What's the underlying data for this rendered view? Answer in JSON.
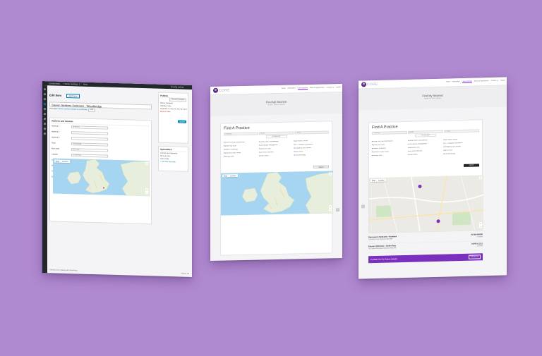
{
  "sheet_wp": {
    "topbar": [
      "Londontown",
      "Theme settings",
      "1",
      "New",
      "Howdy, admin"
    ],
    "heading": "Edit Item",
    "add_new": "Add New",
    "title_value": "Steven Seekers Opticians - Woodbridge",
    "permalink_label": "Permalink:",
    "permalink_url": "steven-seekers-opticians-woodbridge",
    "permalink_button": "Edit",
    "box_title": "Address and location",
    "fields": [
      {
        "label": "Address 1",
        "value": "Station St"
      },
      {
        "label": "Address 2",
        "value": ""
      },
      {
        "label": "Address 3",
        "value": ""
      },
      {
        "label": "Town",
        "value": "Woodbridge"
      },
      {
        "label": "Post code",
        "value": "IP12 1BE"
      },
      {
        "label": "Latitude",
        "value": "52.0904993"
      },
      {
        "label": "Longitude",
        "value": "1.3171505"
      },
      {
        "label": "Website",
        "value": "https://www.stevenseekers.co.uk/woodbridge"
      },
      {
        "label": "Telephone",
        "value": "01394 380000"
      },
      {
        "label": "Email",
        "value": ""
      }
    ],
    "map_tabs": [
      "Map",
      "Satellite"
    ],
    "publish": {
      "title": "Publish",
      "preview": "Preview Changes",
      "status": "Status: Published",
      "visibility": "Visibility: Public",
      "published_on": "Published on: May 26, 2017 @ 13:22",
      "trash": "Move to Trash",
      "update": "Update"
    },
    "services": {
      "title": "Specialities",
      "items": [
        "Contact Lens Specialist",
        "Dry Eye Clinic",
        "Home Visits"
      ],
      "add": "+ Add New Speciality"
    },
    "footer": "Thank you for creating with WordPress.",
    "version": "Version 4.8"
  },
  "sheet_site1": {
    "logo_mark": "e",
    "logo_text": "CORE",
    "nav": [
      "Home",
      "Information",
      "Find a practice",
      "Book an appointment",
      "Contact us",
      "Search"
    ],
    "active_nav": "Find a practice",
    "hero_title": "Find My Nearest",
    "breadcrumb": "Home > Find my nearest",
    "panel_title": "Find A Practice",
    "search_fields": [
      "Postcode",
      "Within",
      "5 miles"
    ],
    "services_dropdown": "All Services",
    "services": [
      "Home Visit Eye Examinations",
      "Contact Lens Consultations",
      "Eye Health Checks",
      "Special Dry Eyes",
      "Child Myopia Management",
      "OCT Imaging Consultation",
      "Diabetic Screening",
      "Glaucoma Clinic",
      "Emergency Eye Service",
      "Specialist Colour Vision",
      "Low Vision Services",
      "Sport Vision",
      "Hearing Tests",
      "Visual Stress",
      "Orthokeratology"
    ],
    "search_button": "Search",
    "map_tabs": [
      "Map",
      "Satellite"
    ]
  },
  "sheet_site2": {
    "logo_mark": "e",
    "logo_text": "CORE",
    "nav": [
      "Home",
      "Information",
      "Find a practice",
      "Book an appointment",
      "Contact us",
      "Search"
    ],
    "active_nav": "Find a practice",
    "hero_title": "Find My Nearest",
    "breadcrumb": "Home > Find my nearest",
    "panel_title": "Find A Practice",
    "search_fields": [
      "Postcode",
      "Within",
      "5 miles"
    ],
    "services_dropdown": "All Services",
    "services": [
      "Home Visit Eye Examinations",
      "Contact Lens Consultations",
      "Eye Health Checks",
      "Special Dry Eyes",
      "Child Myopia Management",
      "OCT Imaging Consultation",
      "Diabetic Screening",
      "Glaucoma Clinic",
      "Emergency Eye Service",
      "Specialist Colour Vision",
      "Low Vision Services",
      "Sport Vision",
      "Hearing Tests",
      "Visual Stress",
      "Orthokeratology"
    ],
    "search_button": "Search",
    "map_tabs": [
      "Map",
      "Satellite"
    ],
    "results": [
      {
        "name": "Specsavers Opticians - Romford",
        "address": "10 Market Place, Romford, RM1 3ER",
        "phone": "01708 000000",
        "distance": "0.4 miles"
      },
      {
        "name": "Eyecare Opticians - Collier Row",
        "address": "101 Collier Row Road, Romford, RM5 3PB",
        "phone": "01708 111111",
        "distance": "1.8 miles"
      }
    ],
    "cta_text": "Contact Us For More Details",
    "cta_button": "Contact Us"
  }
}
